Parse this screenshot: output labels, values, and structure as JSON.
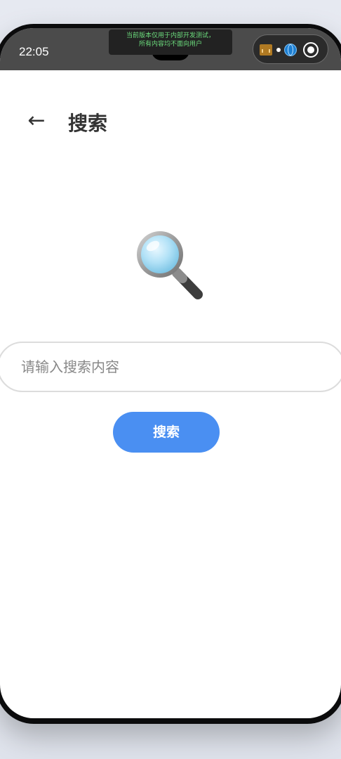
{
  "status_bar": {
    "time": "22:05",
    "dev_banner_line1": "当前版本仅用于内部开发测试，",
    "dev_banner_line2": "所有内容均不面向用户"
  },
  "header": {
    "back_icon": "←",
    "title": "搜索"
  },
  "search": {
    "placeholder": "请输入搜索内容",
    "value": "",
    "button_label": "搜索"
  },
  "colors": {
    "accent": "#4a8ff2",
    "status_bar_bg": "#4b4b4b",
    "banner_text": "#6cdc7d"
  },
  "icons": {
    "magnifier": "magnifying-glass-icon",
    "capsule_left": "app-icon",
    "capsule_globe": "globe-icon",
    "capsule_right": "target-icon"
  }
}
